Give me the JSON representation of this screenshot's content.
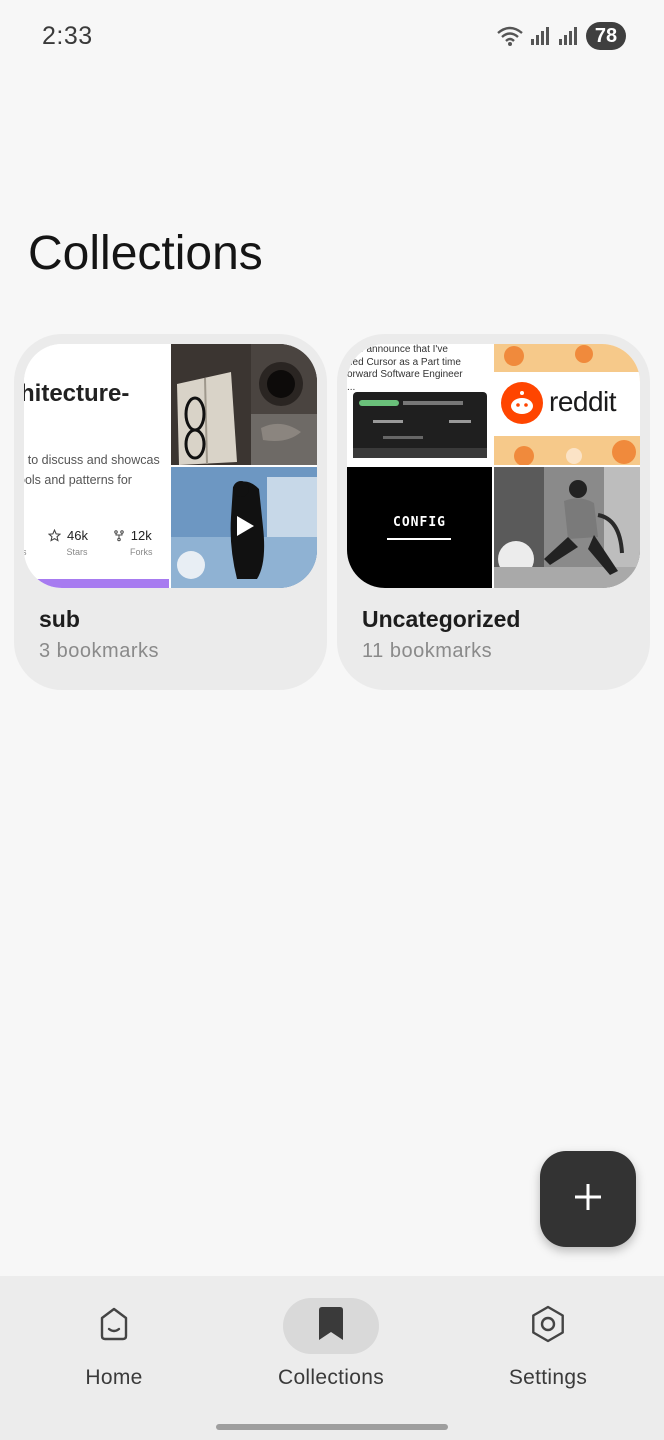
{
  "status_bar": {
    "time": "2:33",
    "battery": "78",
    "icons": [
      "wifi-icon",
      "signal-icon",
      "signal-icon",
      "battery-icon"
    ]
  },
  "page": {
    "title": "Collections"
  },
  "collections": [
    {
      "name": "sub",
      "count": "3 bookmarks",
      "preview": {
        "repo_title": "hitecture-",
        "repo_desc_line1": "s to discuss and showcas",
        "repo_desc_line2": "ools and patterns for",
        "stars_value": "46k",
        "stars_label": "Stars",
        "forks_value": "12k",
        "forks_label": "Forks",
        "left_fragment": "s"
      }
    },
    {
      "name": "Uncategorized",
      "count": "11 bookmarks",
      "preview": {
        "tweet_line1": "d to announce that I've",
        "tweet_line2": "ned Cursor as a Part time",
        "tweet_line3": "orward Software Engineer",
        "tweet_line4": "...",
        "reddit_word": "reddit",
        "config_word": "CONFIG"
      }
    }
  ],
  "fab": {
    "icon": "plus-icon"
  },
  "bottom_nav": {
    "items": [
      {
        "label": "Home",
        "icon": "home-icon",
        "active": false
      },
      {
        "label": "Collections",
        "icon": "bookmark-icon",
        "active": true
      },
      {
        "label": "Settings",
        "icon": "settings-icon",
        "active": false
      }
    ]
  },
  "colors": {
    "background": "#f7f7f7",
    "card": "#ebebeb",
    "fab": "#333333",
    "nav_bg": "#ececec",
    "nav_active_pill": "#d9d9d9",
    "repo_accent": "#a77bf0",
    "reddit_orange": "#ff4500"
  }
}
